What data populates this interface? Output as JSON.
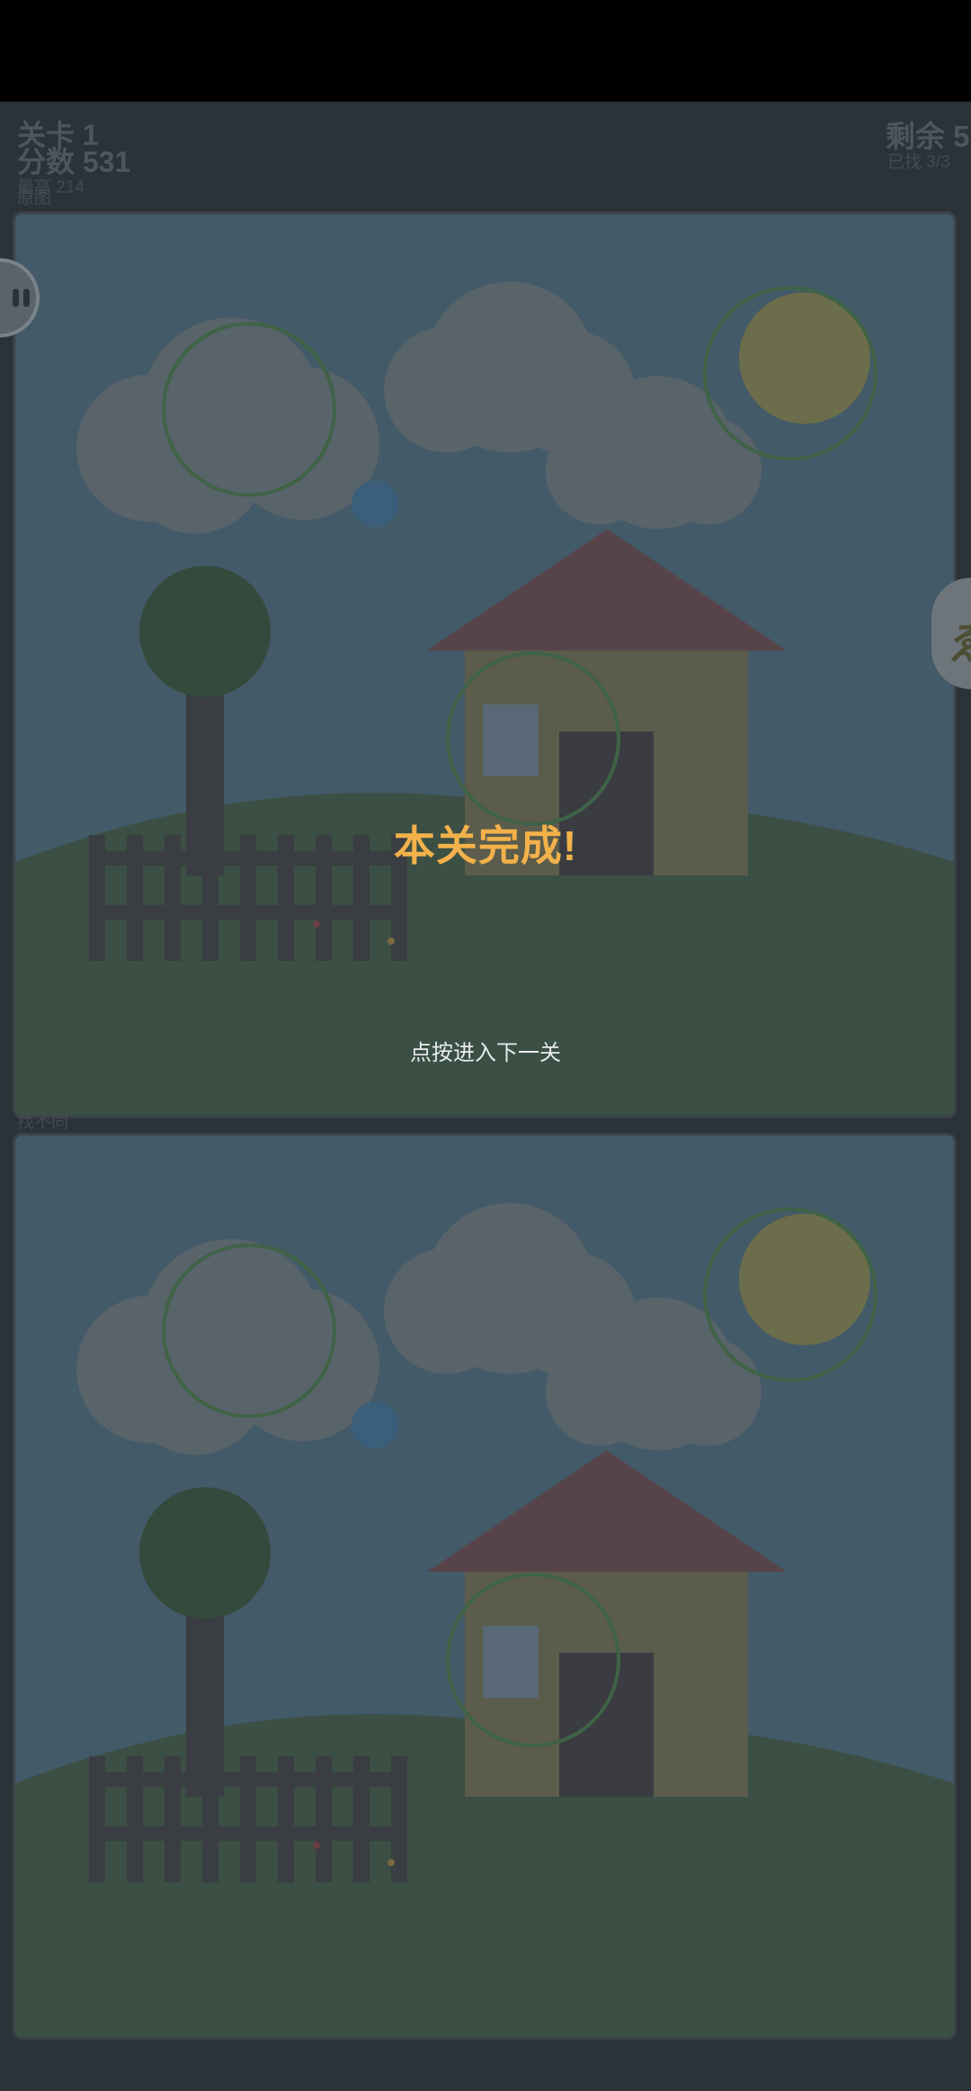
{
  "hud": {
    "level": "关卡 1",
    "score": "分数 531",
    "best": "最高 214",
    "remaining": "剩余 5",
    "found": "已找 3/3"
  },
  "panels": {
    "original_label": "原图",
    "modified_label": "找不同"
  },
  "overlay": {
    "title": "本关完成!",
    "hint": "点按进入下一关"
  },
  "buttons": {
    "right_button_glyph": "ゑ"
  },
  "colors": {
    "sky": "#435a68",
    "hill": "#3b4f44",
    "cloud": "#59636a",
    "sun": "#6c6d4a",
    "roof": "#57444a",
    "wall": "#5b5c4b",
    "door": "#3a3c41",
    "window": "#586877",
    "tree_top": "#344a3c",
    "trunk": "#3a3d41",
    "fence": "#3a3d41",
    "found_circle": "#3f6346",
    "title": "#f2b14a"
  },
  "icons": {
    "left_button": "pause-icon",
    "right_button": "hint-icon"
  }
}
